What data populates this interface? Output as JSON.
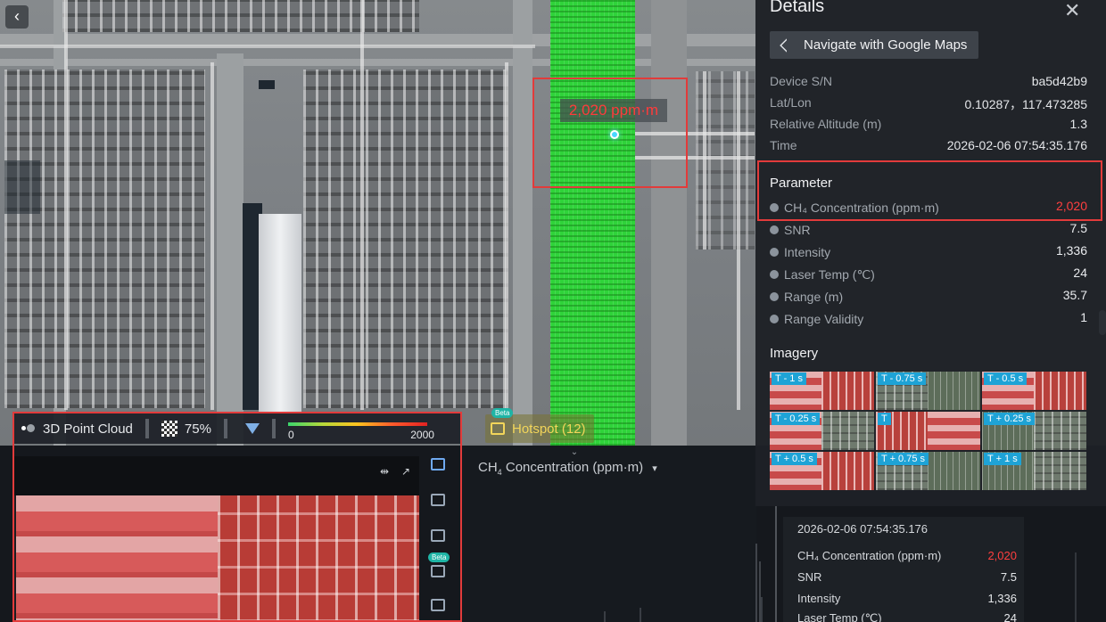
{
  "map": {
    "back_glyph": "‹",
    "hotspot_label": "2,020 ppm·m"
  },
  "toolbar": {
    "point_cloud_label": "3D Point Cloud",
    "opacity_label": "75%",
    "colorbar_min": "0",
    "colorbar_max": "2000",
    "hotspot_label": "Hotspot (12)",
    "beta_label": "Beta"
  },
  "chart": {
    "title_prefix": "CH",
    "title_sub": "4",
    "title_suffix": " Concentration (ppm·m)",
    "dropdown_glyph": "▾",
    "collapse_glyph": "⌄"
  },
  "details": {
    "title": "Details",
    "close_glyph": "✕",
    "navigate_label": "Navigate with Google Maps",
    "info": [
      {
        "key": "Device S/N",
        "value": "ba5d42b9"
      },
      {
        "key": "Lat/Lon",
        "value": "0.10287，117.473285"
      },
      {
        "key": "Relative Altitude (m)",
        "value": "1.3"
      },
      {
        "key": "Time",
        "value": "2026-02-06 07:54:35.176"
      }
    ],
    "parameter_title": "Parameter",
    "parameters": [
      {
        "key": "CH₄ Concentration (ppm·m)",
        "value": "2,020",
        "highlight": true
      },
      {
        "key": "SNR",
        "value": "7.5"
      },
      {
        "key": "Intensity",
        "value": "1,336"
      },
      {
        "key": "Laser Temp (℃)",
        "value": "24"
      },
      {
        "key": "Range (m)",
        "value": "35.7"
      },
      {
        "key": "Range Validity",
        "value": "1"
      }
    ],
    "imagery_title": "Imagery",
    "thumbnails": [
      "T - 1 s",
      "T - 0.75 s",
      "T - 0.5 s",
      "T - 0.25 s",
      "T",
      "T + 0.25 s",
      "T + 0.5 s",
      "T + 0.75 s",
      "T + 1 s"
    ]
  },
  "summary": {
    "time": "2026-02-06 07:54:35.176",
    "rows": [
      {
        "key": "CH₄ Concentration (ppm·m)",
        "value": "2,020",
        "highlight": true
      },
      {
        "key": "SNR",
        "value": "7.5"
      },
      {
        "key": "Intensity",
        "value": "1,336"
      },
      {
        "key": "Laser Temp (℃)",
        "value": "24"
      }
    ]
  },
  "colors": {
    "accent_red": "#ff3f3f",
    "highlight_box": "#e23b3b",
    "point_cloud_green": "#2fd33a",
    "hotspot_yellow": "#f2d55a"
  },
  "icons": [
    "back-icon",
    "point-cloud-icon",
    "opacity-icon",
    "filter-icon",
    "hotspot-icon",
    "navigate-icon",
    "close-icon",
    "info-icon",
    "image-icon",
    "table-icon",
    "expand-icon"
  ]
}
